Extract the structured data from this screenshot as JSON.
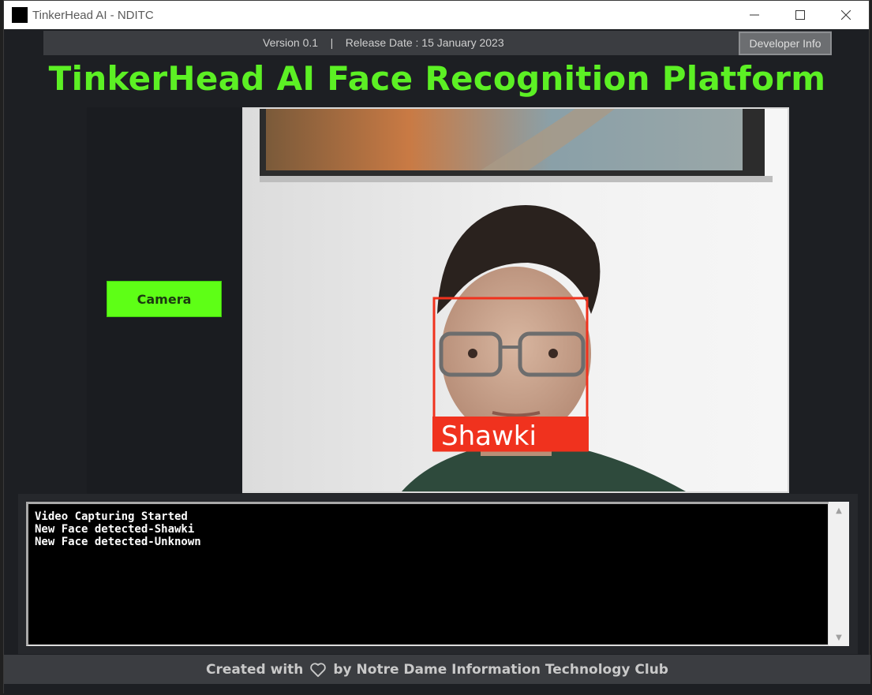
{
  "window": {
    "title": "TinkerHead AI - NDITC"
  },
  "topbar": {
    "info": "Version 0.1    |    Release Date : 15 January 2023",
    "developer_button": "Developer Info"
  },
  "main_title": "TinkerHead AI Face Recognition Platform",
  "camera_button": "Camera",
  "video": {
    "face_label": "Shawki",
    "box_color": "#f0321e"
  },
  "log": {
    "lines": [
      "Video Capturing Started",
      "New Face detected-Shawki",
      "New Face detected-Unknown"
    ]
  },
  "footer": {
    "prefix": "Created with",
    "suffix": "by Notre Dame Information Technology Club",
    "heart_icon": "heart-outline-icon"
  },
  "colors": {
    "accent_green": "#5cf024",
    "button_green": "#5eff16",
    "background": "#1d1f23",
    "bar": "#3b3d41"
  }
}
